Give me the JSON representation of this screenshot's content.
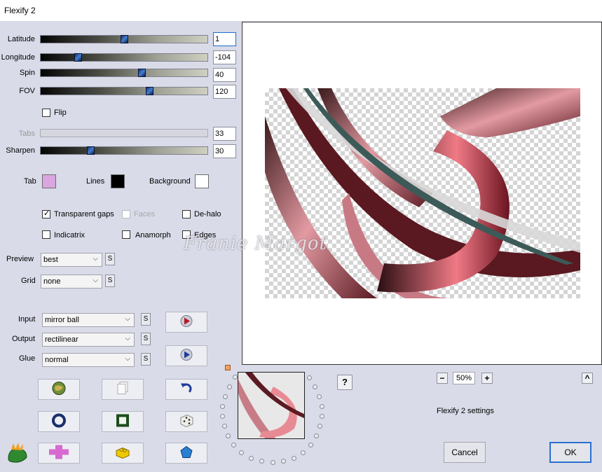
{
  "window": {
    "title": "Flexify 2"
  },
  "sliders": [
    {
      "label": "Latitude",
      "value": "1",
      "level": 0.5,
      "disabled": false,
      "focused": true
    },
    {
      "label": "Longitude",
      "value": "-104",
      "level": 0.22,
      "disabled": false,
      "focused": false
    },
    {
      "label": "Spin",
      "value": "40",
      "level": 0.61,
      "disabled": false,
      "focused": false
    },
    {
      "label": "FOV",
      "value": "120",
      "level": 0.66,
      "disabled": false,
      "focused": false
    },
    {
      "label": "Tabs",
      "value": "33",
      "level": null,
      "disabled": true,
      "focused": false
    },
    {
      "label": "Sharpen",
      "value": "30",
      "level": 0.3,
      "disabled": false,
      "focused": false
    }
  ],
  "flip": {
    "label": "Flip",
    "checked": false
  },
  "colors": {
    "tab_label": "Tab",
    "tab_color": "#d9a6df",
    "lines_label": "Lines",
    "lines_color": "#000000",
    "background_label": "Background",
    "background_color": "#ffffff"
  },
  "options": {
    "transparent_gaps": {
      "label": "Transparent gaps",
      "checked": true
    },
    "faces": {
      "label": "Faces",
      "checked": false,
      "disabled": true
    },
    "de_halo": {
      "label": "De-halo",
      "checked": false
    },
    "indicatrix": {
      "label": "Indicatrix",
      "checked": false
    },
    "anamorph": {
      "label": "Anamorph",
      "checked": false
    },
    "edges": {
      "label": "Edges",
      "checked": false
    }
  },
  "preview_select": {
    "label": "Preview",
    "value": "best",
    "s": "S"
  },
  "grid_select": {
    "label": "Grid",
    "value": "none",
    "s": "S"
  },
  "input_select": {
    "label": "Input",
    "value": "mirror ball",
    "s": "S"
  },
  "output_select": {
    "label": "Output",
    "value": "rectilinear",
    "s": "S"
  },
  "glue_select": {
    "label": "Glue",
    "value": "normal",
    "s": "S"
  },
  "watermark": "Franie Margot",
  "zoom": {
    "minus": "−",
    "value": "50%",
    "plus": "+"
  },
  "help": "?",
  "collapse": "^",
  "settings_label": "Flexify 2 settings",
  "buttons": {
    "cancel": "Cancel",
    "ok": "OK"
  },
  "toolbar_icons": [
    "globe-icon",
    "copy-icon",
    "undo-icon",
    "ring-icon",
    "frame-icon",
    "dice-icon",
    "cross-icon",
    "brick-icon",
    "gem-icon"
  ]
}
